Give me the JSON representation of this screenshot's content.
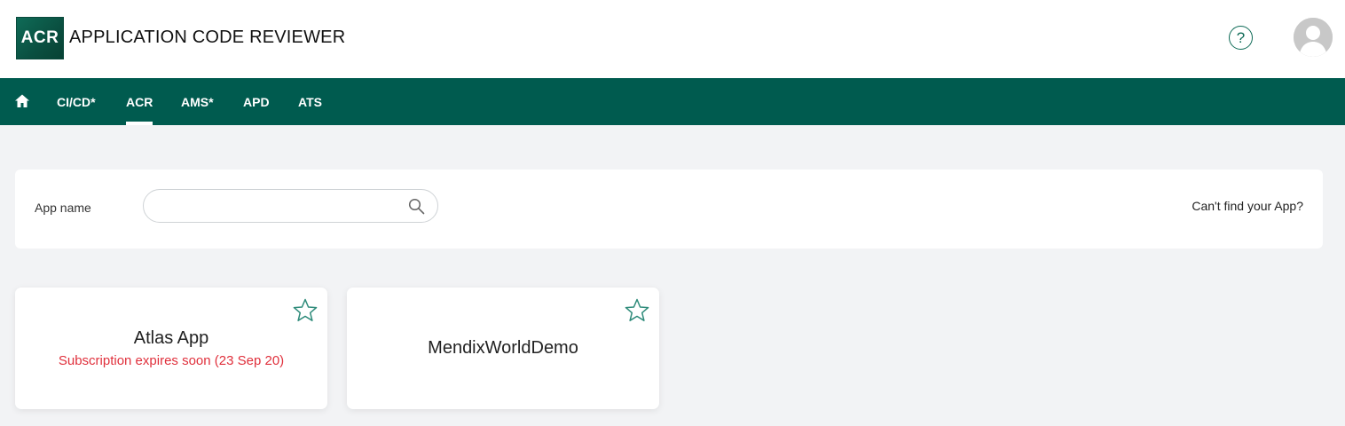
{
  "header": {
    "logo_text": "ACR",
    "title": "APPLICATION CODE REVIEWER",
    "help_symbol": "?",
    "help_icon": "question-circle-icon",
    "avatar_icon": "user-avatar-icon"
  },
  "nav": {
    "home_icon": "home-icon",
    "items": [
      {
        "label": "CI/CD*",
        "active": false
      },
      {
        "label": "ACR",
        "active": true
      },
      {
        "label": "AMS*",
        "active": false
      },
      {
        "label": "APD",
        "active": false
      },
      {
        "label": "ATS",
        "active": false
      }
    ]
  },
  "search": {
    "label": "App name",
    "value": "",
    "placeholder": "",
    "icon": "search-icon",
    "cant_find_link": "Can't find your App?"
  },
  "apps": [
    {
      "name": "Atlas App",
      "subtitle": "Subscription expires soon (23 Sep 20)",
      "favorite": false
    },
    {
      "name": "MendixWorldDemo",
      "subtitle": "",
      "favorite": false
    }
  ],
  "colors": {
    "brand": "#005b4f",
    "accent": "#0f6b57",
    "warning": "#e0303c",
    "background": "#f2f3f5"
  }
}
